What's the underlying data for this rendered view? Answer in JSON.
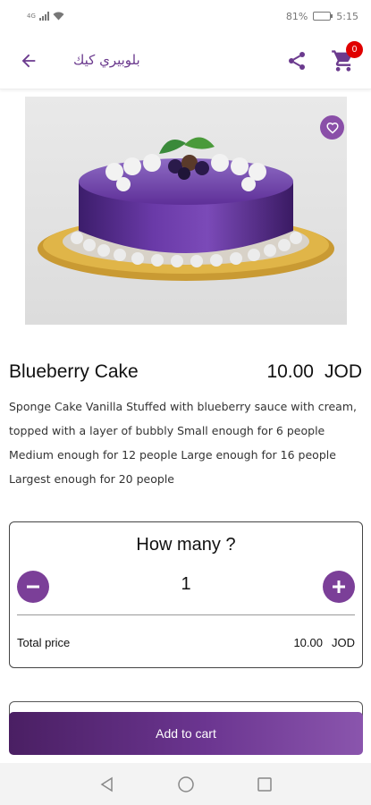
{
  "status_bar": {
    "network": "4G",
    "battery_percent": "81%",
    "battery_level": 0.81,
    "time": "5:15"
  },
  "app_bar": {
    "title": "بلوبيري كيك",
    "cart_count": "0",
    "icons": [
      "arrow-back-icon",
      "share-icon",
      "cart-icon"
    ]
  },
  "product": {
    "name": "Blueberry Cake",
    "price": "10.00",
    "currency": "JOD",
    "description": "Sponge Cake Vanilla Stuffed with blueberry sauce with cream, topped with a layer of bubbly Small enough for 6 people Medium enough for 12 people Large enough for 16 people Largest enough for 20 people",
    "favorite_icon": "heart-icon"
  },
  "quantity": {
    "title": "How many ?",
    "value": "1",
    "total_label": "Total price",
    "total_value": "10.00",
    "total_currency": "JOD"
  },
  "actions": {
    "add_to_cart": "Add to cart"
  },
  "colors": {
    "accent": "#7b3f98",
    "accent_dark": "#4a1f63",
    "badge": "#e00000"
  }
}
